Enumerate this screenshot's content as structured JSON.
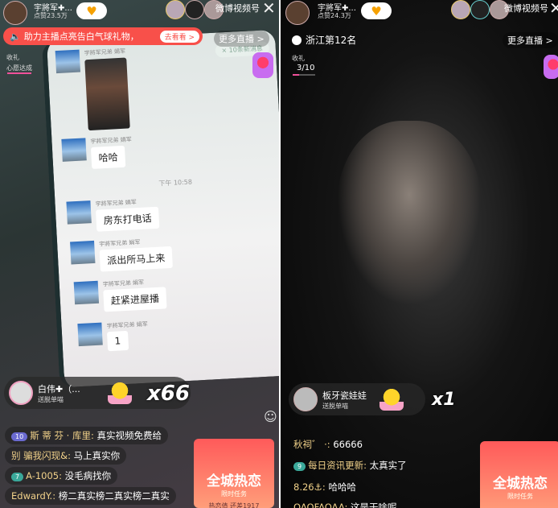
{
  "left": {
    "streamer": {
      "name": "宇將军✚...",
      "likes": "点赞23.5万"
    },
    "weibo_label": "微博视频号",
    "banner": {
      "text": "助力主播点亮告白气球礼物，",
      "button": "去看看 >"
    },
    "more_live": "更多直播 >",
    "gift_goal": {
      "label": "收礼",
      "status": "心愿达成"
    },
    "phone_chat": {
      "unread": "× 10条新消息",
      "time": "下午 10:58",
      "messages": [
        {
          "sender": "宇將军兄弟 娟军",
          "text": ""
        },
        {
          "sender": "宇將军兄弟 娟军",
          "text": "哈哈"
        },
        {
          "sender": "宇將军兄弟 娟军",
          "text": "房东打电话"
        },
        {
          "sender": "宇將军兄弟 娟军",
          "text": "派出所马上来"
        },
        {
          "sender": "宇將军兄弟 娟军",
          "text": "赶紧进屋播"
        },
        {
          "sender": "宇將军兄弟 娟军",
          "text": "1"
        }
      ]
    },
    "gift": {
      "user": "白伟✚（...",
      "action": "送脱单喵",
      "combo": "x66"
    },
    "comments": [
      {
        "level": "10",
        "user": "斯 蒂 芬 · 库里:",
        "text": "真实视频免费给"
      },
      {
        "level": "",
        "user": "别 骗我闪现&:",
        "text": "马上真实你"
      },
      {
        "level": "7",
        "user": "A-1005:",
        "text": "没毛病找你"
      },
      {
        "level": "",
        "user": "EdwardY.:",
        "text": "榜二真实榜二真实榜二真实"
      }
    ],
    "promo": {
      "title": "全城热恋",
      "subtitle": "限时任务",
      "footer": "热恋值 还差1917"
    }
  },
  "right": {
    "streamer": {
      "name": "宇將军✚...",
      "likes": "点赞24.3万"
    },
    "weibo_label": "微博视频号",
    "rank": "浙江第12名",
    "more_live": "更多直播 >",
    "gift_goal": {
      "label": "收礼",
      "progress": "3/10",
      "fraction": 0.3
    },
    "gift": {
      "user": "板牙瓷娃娃",
      "action": "送脱单喵",
      "combo": "x1"
    },
    "comments": [
      {
        "level": "",
        "user": "秋祠゛ ·:",
        "text": "66666"
      },
      {
        "level": "9",
        "user": "每日资讯更新:",
        "text": "太真实了"
      },
      {
        "level": "",
        "user": "8.26⚓:",
        "text": "哈哈哈"
      },
      {
        "level": "",
        "user": "OAOFAOAA:",
        "text": "这是干啥呢"
      }
    ],
    "promo": {
      "title": "全城热恋",
      "subtitle": "限时任务"
    }
  },
  "colors": {
    "banner_red": "#f8504a",
    "username_gold": "#f2d28a",
    "promo_red": "#ff5a5a"
  }
}
